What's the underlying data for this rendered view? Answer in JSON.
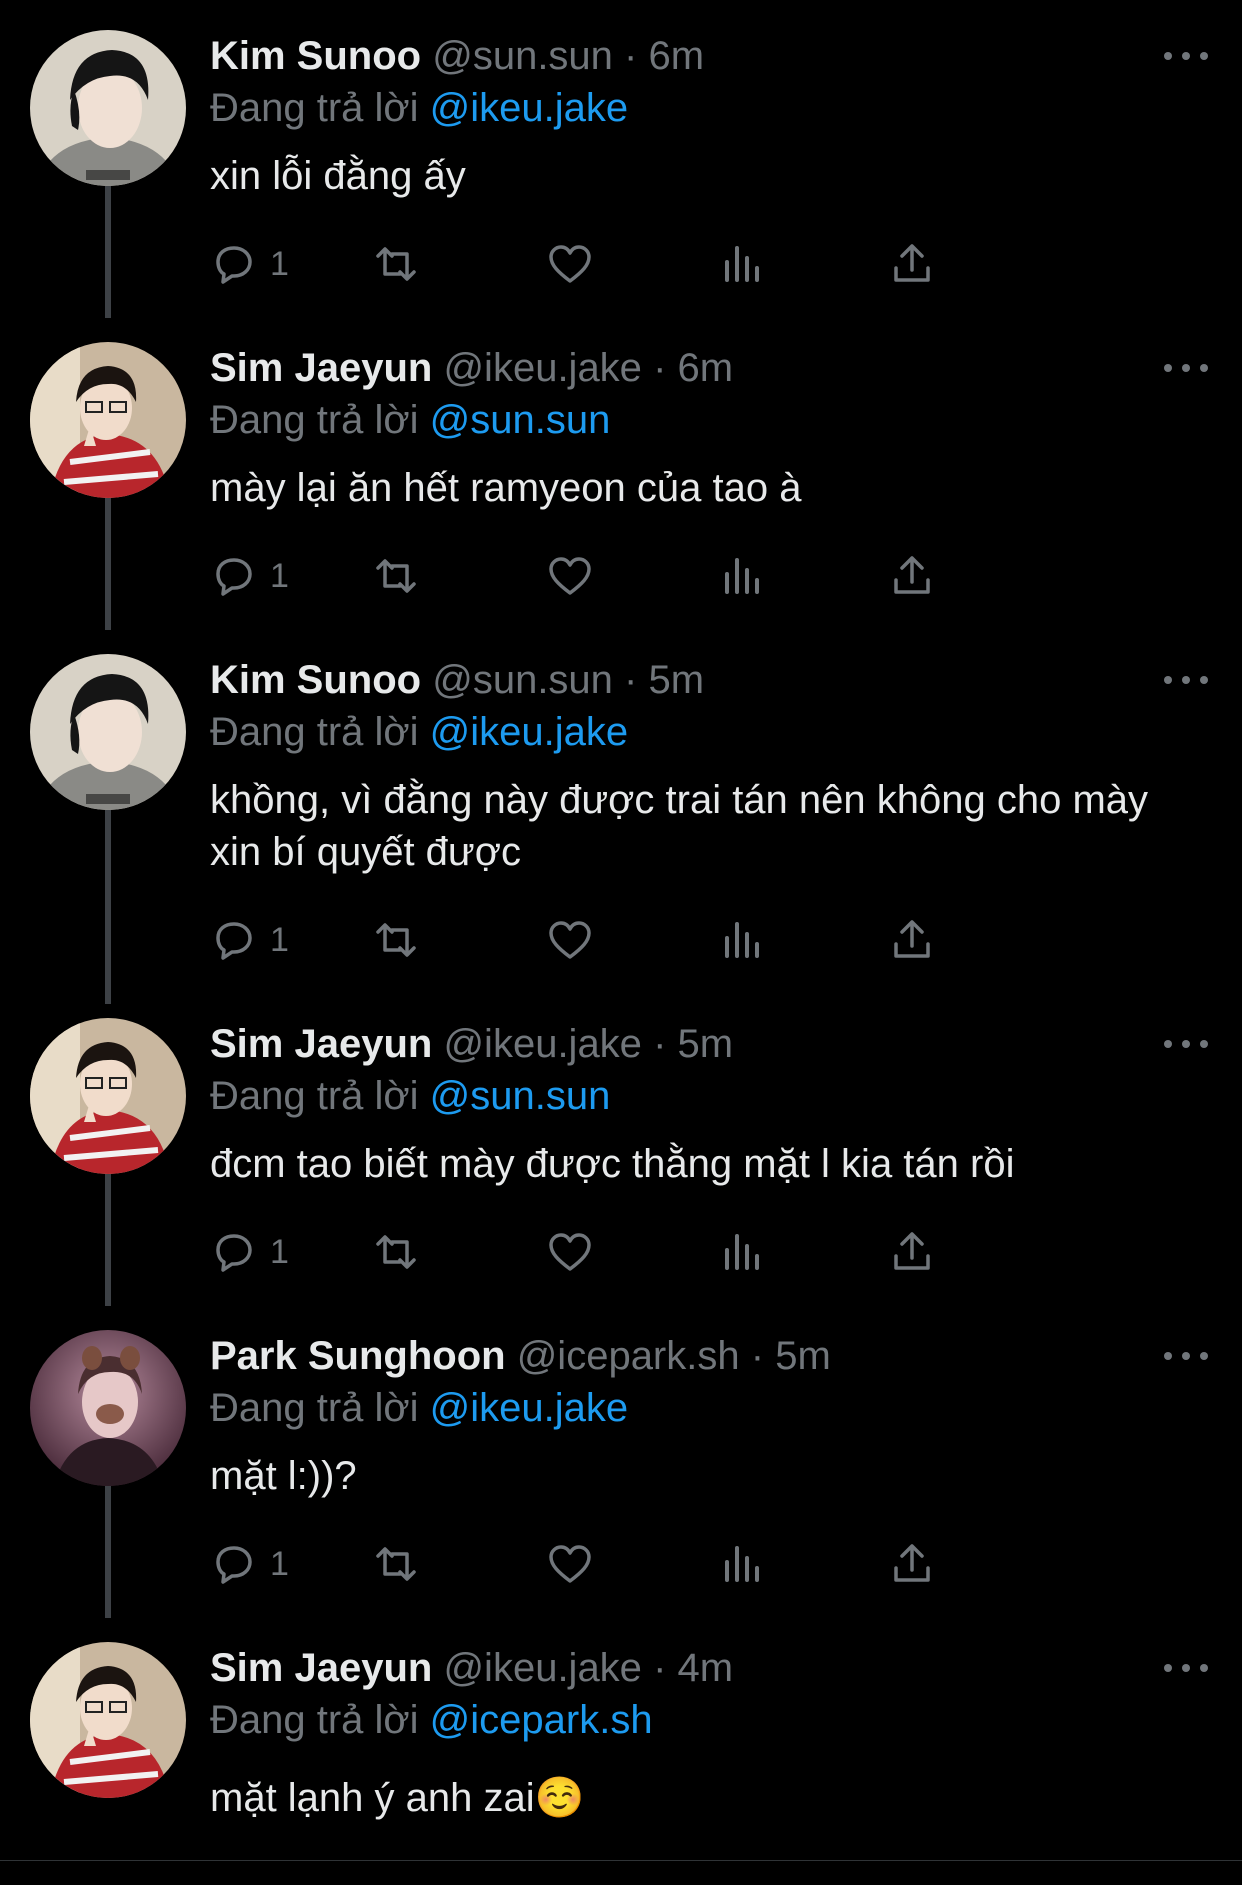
{
  "colors": {
    "background": "#000000",
    "text_primary": "#e7e9ea",
    "text_secondary": "#71767b",
    "mention": "#1d9bf0",
    "thread_line": "#3d4146"
  },
  "tweets": [
    {
      "name": "Kim Sunoo",
      "handle": "@sun.sun",
      "dot": "·",
      "time": "6m",
      "reply_prefix": "Đang trả lời",
      "reply_to": "@ikeu.jake",
      "text": "xin lỗi đằng ấy",
      "reply_count": "1",
      "avatar": "sunoo-avatar"
    },
    {
      "name": "Sim Jaeyun",
      "handle": "@ikeu.jake",
      "dot": "·",
      "time": "6m",
      "reply_prefix": "Đang trả lời",
      "reply_to": "@sun.sun",
      "text": "mày lại ăn hết ramyeon của tao à",
      "reply_count": "1",
      "avatar": "jaeyun-avatar"
    },
    {
      "name": "Kim Sunoo",
      "handle": "@sun.sun",
      "dot": "·",
      "time": "5m",
      "reply_prefix": "Đang trả lời",
      "reply_to": "@ikeu.jake",
      "text": "khồng, vì đằng này được trai tán nên không cho mày xin bí quyết được",
      "reply_count": "1",
      "avatar": "sunoo-avatar"
    },
    {
      "name": "Sim Jaeyun",
      "handle": "@ikeu.jake",
      "dot": "·",
      "time": "5m",
      "reply_prefix": "Đang trả lời",
      "reply_to": "@sun.sun",
      "text": "đcm tao biết mày được thằng mặt l kia tán rồi",
      "reply_count": "1",
      "avatar": "jaeyun-avatar"
    },
    {
      "name": "Park Sunghoon",
      "handle": "@icepark.sh",
      "dot": "·",
      "time": "5m",
      "reply_prefix": "Đang trả lời",
      "reply_to": "@ikeu.jake",
      "text": "mặt l:))?",
      "reply_count": "1",
      "avatar": "sunghoon-avatar"
    },
    {
      "name": "Sim Jaeyun",
      "handle": "@ikeu.jake",
      "dot": "·",
      "time": "4m",
      "reply_prefix": "Đang trả lời",
      "reply_to": "@icepark.sh",
      "text": "mặt lạnh ý anh zai☺️",
      "reply_count": "",
      "avatar": "jaeyun-avatar"
    }
  ],
  "icons": [
    "reply-icon",
    "retweet-icon",
    "like-icon",
    "views-icon",
    "share-icon",
    "more-icon"
  ]
}
